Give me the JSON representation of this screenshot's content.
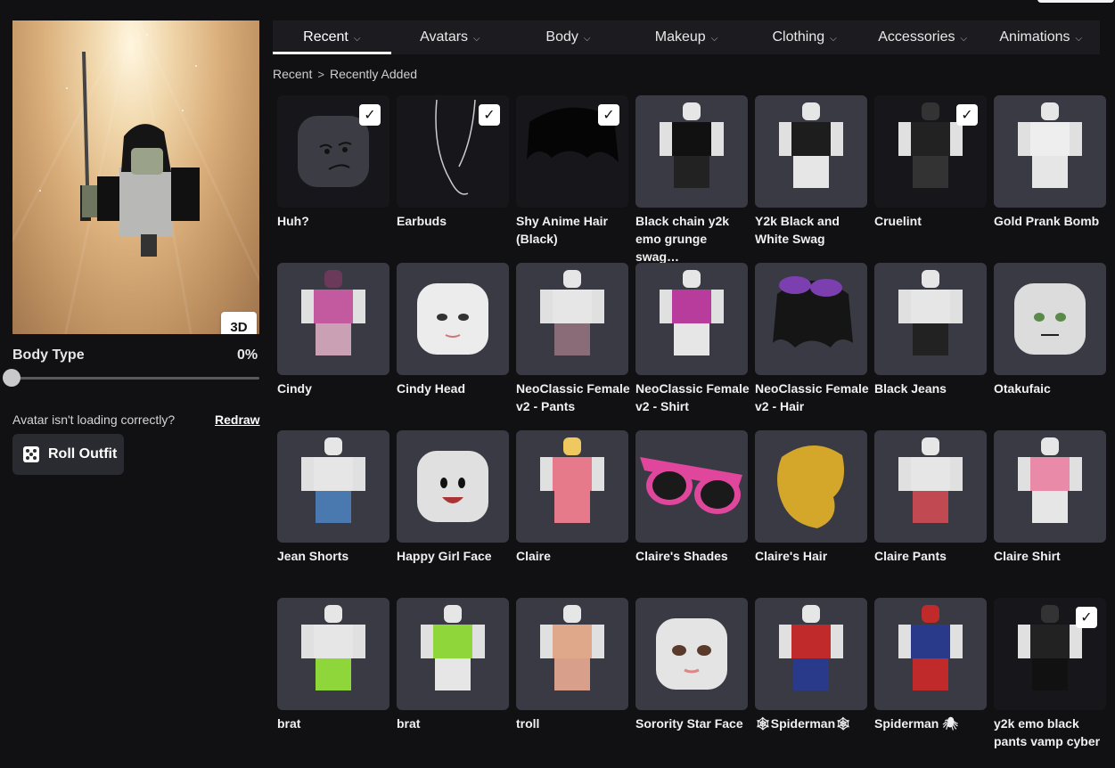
{
  "tabs": [
    {
      "label": "Recent",
      "active": true
    },
    {
      "label": "Avatars",
      "active": false
    },
    {
      "label": "Body",
      "active": false
    },
    {
      "label": "Makeup",
      "active": false
    },
    {
      "label": "Clothing",
      "active": false
    },
    {
      "label": "Accessories",
      "active": false
    },
    {
      "label": "Animations",
      "active": false
    }
  ],
  "breadcrumb": {
    "root": "Recent",
    "current": "Recently Added"
  },
  "preview": {
    "view_button": "3D"
  },
  "body_type": {
    "label": "Body Type",
    "value": "0%",
    "fraction": 0
  },
  "avatar_help": {
    "message": "Avatar isn't loading correctly?",
    "redraw": "Redraw"
  },
  "roll_outfit": {
    "label": "Roll Outfit"
  },
  "items": [
    {
      "name": "Huh?",
      "equipped": true,
      "kind": "face-dark"
    },
    {
      "name": "Earbuds",
      "equipped": true,
      "kind": "earbuds"
    },
    {
      "name": "Shy Anime Hair (Black)",
      "equipped": true,
      "kind": "hair-dark"
    },
    {
      "name": "Black chain y2k emo grunge swag…",
      "equipped": false,
      "kind": "outfit-black"
    },
    {
      "name": "Y2k Black and White Swag",
      "equipped": false,
      "kind": "outfit-bw"
    },
    {
      "name": "Cruelint",
      "equipped": true,
      "kind": "outfit-dark"
    },
    {
      "name": "Gold Prank Bomb",
      "equipped": false,
      "kind": "outfit-gold"
    },
    {
      "name": "Cindy",
      "equipped": false,
      "kind": "char-cindy"
    },
    {
      "name": "Cindy Head",
      "equipped": false,
      "kind": "face-cindy"
    },
    {
      "name": "NeoClassic Female v2 - Pants",
      "equipped": false,
      "kind": "outfit-pants"
    },
    {
      "name": "NeoClassic Female v2 - Shirt",
      "equipped": false,
      "kind": "outfit-pink"
    },
    {
      "name": "NeoClassic Female v2 - Hair",
      "equipped": false,
      "kind": "hair-purple"
    },
    {
      "name": "Black Jeans",
      "equipped": false,
      "kind": "outfit-jeans"
    },
    {
      "name": "Otakufaic",
      "equipped": false,
      "kind": "face-otaku"
    },
    {
      "name": "Jean Shorts",
      "equipped": false,
      "kind": "outfit-shorts"
    },
    {
      "name": "Happy Girl Face",
      "equipped": false,
      "kind": "face-happy"
    },
    {
      "name": "Claire",
      "equipped": false,
      "kind": "char-claire"
    },
    {
      "name": "Claire's Shades",
      "equipped": false,
      "kind": "shades"
    },
    {
      "name": "Claire's Hair",
      "equipped": false,
      "kind": "hair-gold"
    },
    {
      "name": "Claire Pants",
      "equipped": false,
      "kind": "outfit-redpants"
    },
    {
      "name": "Claire Shirt",
      "equipped": false,
      "kind": "outfit-pinkshirt"
    },
    {
      "name": "brat",
      "equipped": false,
      "kind": "outfit-brat1"
    },
    {
      "name": "brat",
      "equipped": false,
      "kind": "outfit-brat2"
    },
    {
      "name": "troll",
      "equipped": false,
      "kind": "outfit-troll"
    },
    {
      "name": "Sorority Star Face",
      "equipped": false,
      "kind": "face-sorority"
    },
    {
      "name": "🕸Spiderman🕸",
      "equipped": false,
      "kind": "outfit-spider1"
    },
    {
      "name": "Spiderman 🕷",
      "equipped": false,
      "kind": "outfit-spider2"
    },
    {
      "name": "y2k emo black pants vamp cyber",
      "equipped": true,
      "kind": "outfit-vamp"
    }
  ],
  "colors": {
    "background": "#111114",
    "tile": "#393a44",
    "tile_dark": "#17171b",
    "tab_bar": "#1c1c20",
    "roll_button": "#2a2b30"
  }
}
